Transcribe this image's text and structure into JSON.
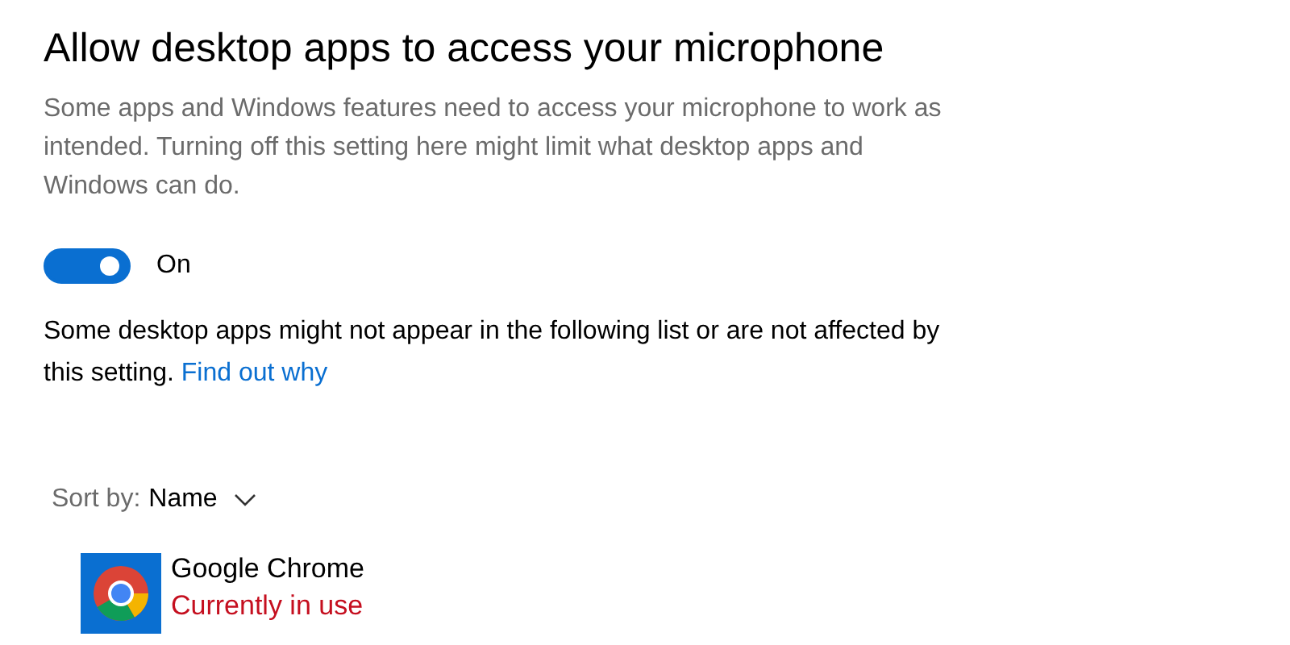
{
  "title": "Allow desktop apps to access your microphone",
  "description": "Some apps and Windows features need to access your microphone to work as intended. Turning off this setting here might limit what desktop apps and Windows can do.",
  "toggle": {
    "on": true,
    "label": "On"
  },
  "note": {
    "text": "Some desktop apps might not appear in the following list or are not affected by this setting.",
    "link": "Find out why"
  },
  "sort": {
    "label": "Sort by:",
    "value": "Name"
  },
  "apps": [
    {
      "name": "Google Chrome",
      "status": "Currently in use"
    }
  ]
}
